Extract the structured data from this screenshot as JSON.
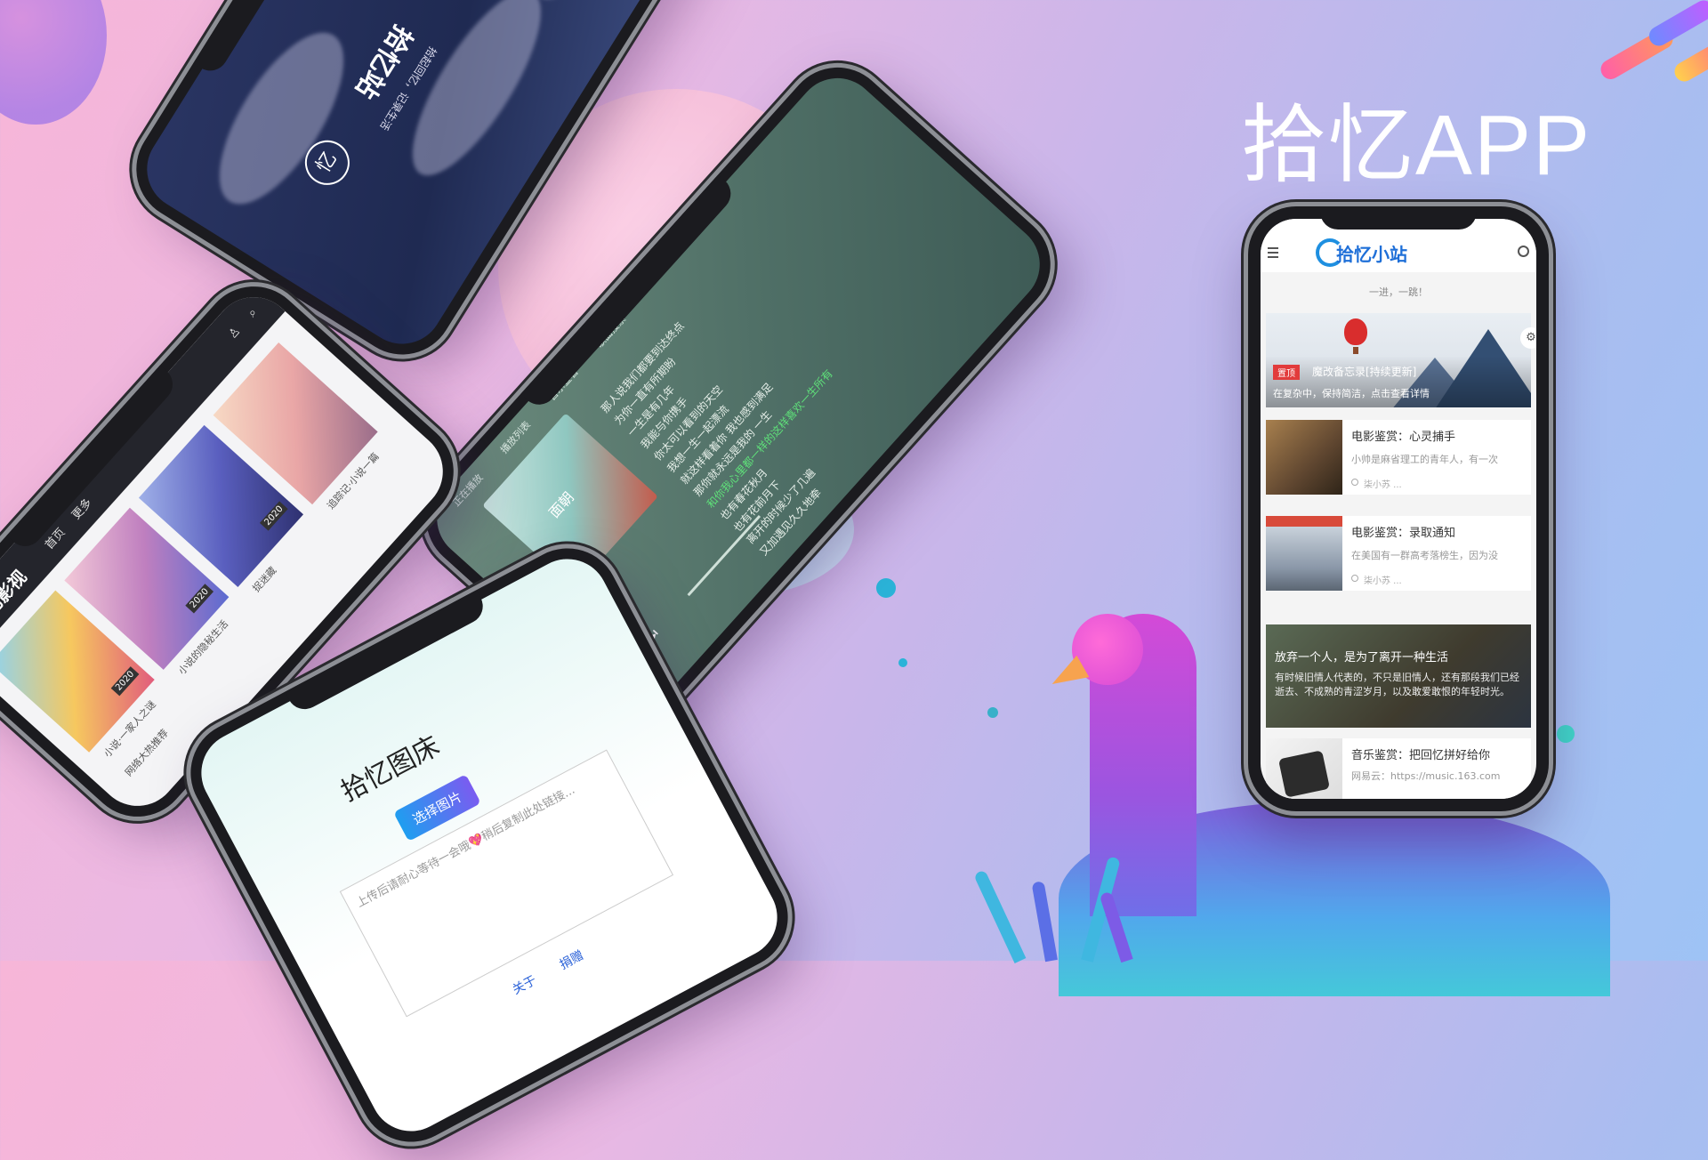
{
  "headline": "拾忆APP",
  "phone_night": {
    "title": "拾忆站",
    "subtitle": "拾起回忆，记录生活",
    "badge": "忆"
  },
  "phone_music": {
    "status_tabs": [
      "正在播放",
      "播放列表",
      "音乐查看",
      "歌曲搜索"
    ],
    "album_title": "面朝",
    "lyrics": [
      "那人说我们都要到达终点",
      "为你一直有所期盼",
      "一生是有几年",
      "我能与你携手",
      "你太可以看到的天空",
      "我想一生一起漂流",
      "就这样看着你 我也感到满足",
      "那你就永远是我的 一生"
    ],
    "lyrics_highlight": "和你我心里都一样的这样喜欢一生所有",
    "lyrics_more": [
      "也有春花秋月",
      "也有花前月下",
      "离开的时候少了几遍",
      "又加遇见久久地牵"
    ]
  },
  "phone_video": {
    "brand": "拾忆影视",
    "nav": [
      "首页",
      "更多"
    ],
    "tags": [
      "2020",
      "2020",
      "2020"
    ],
    "captions": [
      "小说·一家人之谜",
      "小说的隐秘生活",
      "捉迷藏",
      "追踪记·小说一篇",
      "网络大热推荐"
    ]
  },
  "phone_img": {
    "title": "拾忆图床",
    "select_button": "选择图片",
    "hint": "上传后请耐心等待一会哦💖稍后复制此处链接...",
    "links": [
      "关于",
      "捐赠"
    ]
  },
  "main_phone": {
    "logo": "拾忆小站",
    "slogan": "一进，一跳！",
    "banner": {
      "pin_label": "置顶",
      "title": "魔改备忘录[持续更新]",
      "subtitle": "在复杂中，保持简洁，点击查看详情"
    },
    "cards": [
      {
        "title": "电影鉴赏：心灵捕手",
        "summary": "小帅是麻省理工的青年人，有一次",
        "author": "柒小苏 ..."
      },
      {
        "title": "电影鉴赏：录取通知",
        "summary": "在美国有一群高考落榜生，因为没",
        "author": "柒小苏 ..."
      }
    ],
    "feature": {
      "title": "放弃一个人，是为了离开一种生活",
      "desc": "有时候旧情人代表的，不只是旧情人，还有那段我们已经逝去、不成熟的青涩岁月，以及敢爱敢恨的年轻时光。"
    },
    "music_card": {
      "title": "音乐鉴赏：把回忆拼好给你",
      "summary": "网易云：https://music.163.com"
    }
  },
  "colors": {
    "accent": "#1e6fd8",
    "pin": "#e23b3b",
    "lyric_highlight": "#5fe07a"
  }
}
